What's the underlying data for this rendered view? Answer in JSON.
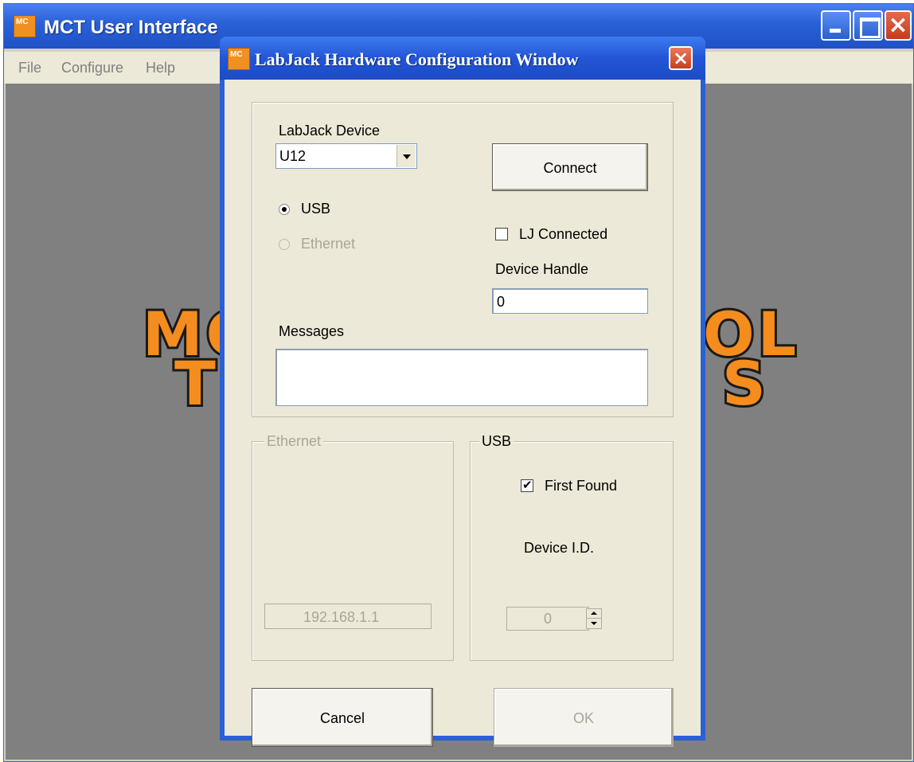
{
  "main_window": {
    "title": "MCT User Interface",
    "icon_text": "MC",
    "menu": [
      "File",
      "Configure",
      "Help"
    ],
    "background_logo": {
      "left_fragment": "MC",
      "right_fragment": "OL",
      "left_fragment_2": "T",
      "right_fragment_2": "S"
    },
    "controls": {
      "minimize": "minimize-icon",
      "maximize": "maximize-icon",
      "close": "×"
    }
  },
  "dialog": {
    "title": "LabJack Hardware Configuration Window",
    "icon_text": "MC",
    "close_glyph": "×",
    "device_label": "LabJack Device",
    "device_value": "U12",
    "connect_label": "Connect",
    "radio_usb": "USB",
    "radio_ethernet": "Ethernet",
    "lj_connected_label": "LJ Connected",
    "lj_connected_checked": false,
    "device_handle_label": "Device Handle",
    "device_handle_value": "0",
    "messages_label": "Messages",
    "messages_value": "",
    "ethernet_group": {
      "title": "Ethernet",
      "ip_value": "192.168.1.1"
    },
    "usb_group": {
      "title": "USB",
      "first_found_label": "First Found",
      "first_found_checked": true,
      "device_id_label": "Device I.D.",
      "device_id_value": "0"
    },
    "cancel_label": "Cancel",
    "ok_label": "OK"
  },
  "colors": {
    "titlebar": "#2b62d8",
    "dialog_bg": "#ece9d8",
    "client_bg": "#808080",
    "logo": "#f58c1e"
  }
}
